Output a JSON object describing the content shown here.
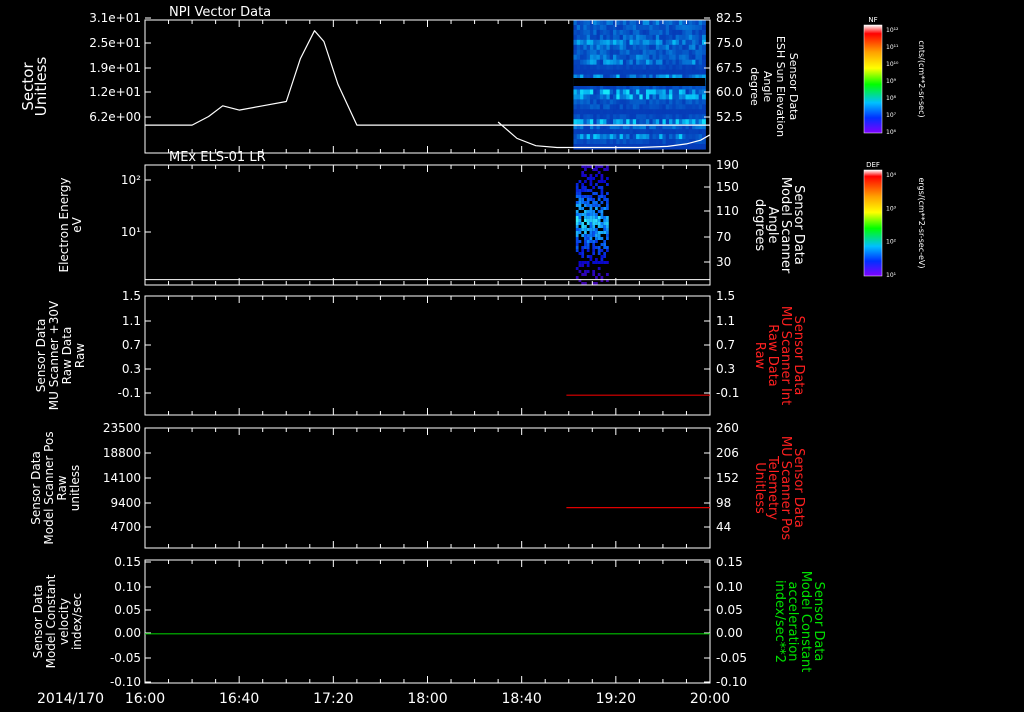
{
  "date_label": "2014/170",
  "time_ticks": [
    "16:00",
    "16:40",
    "17:20",
    "18:00",
    "18:40",
    "19:20",
    "20:00"
  ],
  "time_range_minutes": [
    0,
    240
  ],
  "colors": {
    "axis": "#ffffff",
    "trace_white": "#ffffff",
    "trace_red": "#e00000",
    "trace_green": "#00c000",
    "right_red": "#ff2020",
    "right_green": "#00e000"
  },
  "colorbars": [
    {
      "title": "NF",
      "ticks": [
        "10¹²",
        "10¹¹",
        "10¹⁰",
        "10⁹",
        "10⁸",
        "10⁷",
        "10⁶"
      ],
      "unit": "cnts/(cm**2-sr-sec)"
    },
    {
      "title": "DEF",
      "ticks": [
        "10⁴",
        "10³",
        "10²",
        "10¹"
      ],
      "unit": "ergs/(cm**2-sr-sec-eV)"
    }
  ],
  "chart_data": [
    {
      "type": "line",
      "title": "NPI Vector Data",
      "ylabel": [
        "Sector",
        "Unitless"
      ],
      "y_ticks": [
        "3.1e+01",
        "2.5e+01",
        "1.9e+01",
        "1.2e+01",
        "6.2e+00"
      ],
      "ylim": [
        0,
        31
      ],
      "right_ylabel": [
        "Sensor Data",
        "ESH Sun Elevation",
        "Angle",
        "degree"
      ],
      "right_ticks": [
        "82.5",
        "75.0",
        "67.5",
        "60.0",
        "52.5"
      ],
      "right_ylim": [
        46,
        82.5
      ],
      "series": [
        {
          "x": [
            0,
            20,
            27,
            33,
            40,
            50,
            60,
            66,
            72,
            76,
            82,
            90,
            97,
            110,
            150,
            165,
            175,
            185,
            200,
            215,
            225,
            230,
            235,
            240
          ],
          "y": [
            6.5,
            6.5,
            8.5,
            11,
            10,
            11,
            12,
            22,
            28.5,
            26,
            16,
            6.5,
            6.5,
            6.5,
            6.5,
            6.5,
            6.5,
            6.5,
            6.5,
            6.5,
            6.5,
            6.5,
            6.5,
            6.5
          ]
        },
        {
          "x": [
            150,
            158,
            166,
            175,
            190,
            210,
            222,
            230,
            236,
            240
          ],
          "y": [
            54.5,
            50,
            48,
            47.5,
            47.5,
            47.5,
            47.8,
            48.5,
            49.5,
            51
          ]
        }
      ],
      "spectrogram": {
        "x_range": [
          182,
          238
        ],
        "colorscale": "NF"
      }
    },
    {
      "type": "scatter",
      "title": "MEx ELS-01 LR",
      "ylabel": [
        "Electron Energy",
        "eV"
      ],
      "y_ticks": [
        "10²",
        "10¹"
      ],
      "right_ylabel": [
        "Sensor Data",
        "Model Scanner",
        "Angle",
        "degrees"
      ],
      "right_ticks": [
        "190",
        "150",
        "110",
        "70",
        "30"
      ],
      "right_ylim": [
        10,
        190
      ],
      "series": [
        {
          "x": [
            0,
            240
          ],
          "y": [
            18,
            18
          ]
        }
      ],
      "spectrogram": {
        "x_range": [
          183,
          197
        ],
        "colorscale": "DEF"
      }
    },
    {
      "type": "line",
      "ylabel": [
        "Sensor Data",
        "MU Scanner +30V",
        "Raw Data",
        "Raw"
      ],
      "y_ticks": [
        "1.5",
        "1.1",
        "0.7",
        "0.3",
        "-0.1"
      ],
      "ylim": [
        -0.3,
        1.5
      ],
      "right_ylabel": [
        "Sensor Data",
        "MU Scanner Int",
        "Raw Data",
        "Raw"
      ],
      "right_ticks": [
        "1.5",
        "1.1",
        "0.7",
        "0.3",
        "-0.1"
      ],
      "series": [
        {
          "x": [
            179,
            240
          ],
          "y": [
            0.0,
            0.0
          ]
        }
      ]
    },
    {
      "type": "line",
      "ylabel": [
        "Sensor Data",
        "Model Scanner Pos",
        "Raw",
        "unitless"
      ],
      "y_ticks": [
        "23500",
        "18800",
        "14100",
        "9400",
        "4700"
      ],
      "ylim": [
        0,
        23500
      ],
      "right_ylabel": [
        "Sensor Data",
        "MU Scanner Pos",
        "Telemetry",
        "Unitless"
      ],
      "right_ticks": [
        "260",
        "206",
        "152",
        "98",
        "44"
      ],
      "series": [
        {
          "x": [
            179,
            240
          ],
          "y": [
            7900,
            7900
          ]
        }
      ]
    },
    {
      "type": "line",
      "ylabel": [
        "Sensor Data",
        "Model Constant",
        "velocity",
        "index/sec"
      ],
      "y_ticks": [
        "0.15",
        "0.10",
        "0.05",
        "0.00",
        "-0.05",
        "-0.10"
      ],
      "ylim": [
        -0.1,
        0.15
      ],
      "right_ylabel": [
        "Sensor Data",
        "Model Constant",
        "acceleration",
        "index/sec**2"
      ],
      "right_ticks": [
        "0.15",
        "0.10",
        "0.05",
        "0.00",
        "-0.05",
        "-0.10"
      ],
      "series": [
        {
          "x": [
            0,
            240
          ],
          "y": [
            0.0,
            0.0
          ]
        }
      ]
    }
  ]
}
